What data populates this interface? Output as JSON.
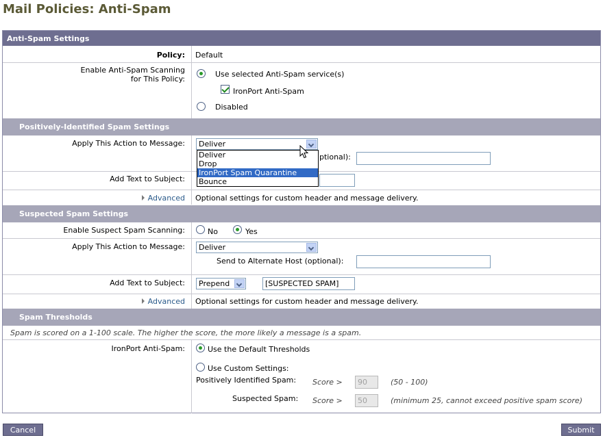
{
  "page": {
    "title": "Mail Policies: Anti-Spam"
  },
  "settings": {
    "header": "Anti-Spam Settings",
    "policy_label": "Policy:",
    "policy_value": "Default",
    "enable_label_1": "Enable Anti-Spam Scanning",
    "enable_label_2": "for This Policy:",
    "use_service": "Use selected Anti-Spam service(s)",
    "ironport": "IronPort Anti-Spam",
    "disabled": "Disabled"
  },
  "positive": {
    "header": "Positively-Identified Spam Settings",
    "action_label": "Apply This Action to Message:",
    "action_value": "Deliver",
    "alt_host_partial": "ptional):",
    "options": [
      "Deliver",
      "Drop",
      "IronPort Spam Quarantine",
      "Bounce"
    ],
    "subject_label": "Add Text to Subject:",
    "advanced": "Advanced",
    "advanced_desc": "Optional settings for custom header and message delivery."
  },
  "suspected": {
    "header": "Suspected Spam Settings",
    "enable_label": "Enable Suspect Spam Scanning:",
    "no": "No",
    "yes": "Yes",
    "action_label": "Apply This Action to Message:",
    "action_value": "Deliver",
    "alt_host_label": "Send to Alternate Host (optional):",
    "subject_label": "Add Text to Subject:",
    "subject_mode": "Prepend",
    "subject_text": "[SUSPECTED SPAM]",
    "advanced": "Advanced",
    "advanced_desc": "Optional settings for custom header and message delivery."
  },
  "thresholds": {
    "header": "Spam Thresholds",
    "note": "Spam is scored on a 1-100 scale. The higher the score, the more likely a message is a spam.",
    "engine_label": "IronPort Anti-Spam:",
    "default": "Use the Default Thresholds",
    "custom": "Use Custom Settings:",
    "positive_label": "Positively Identified Spam:",
    "score_gt": "Score >",
    "positive_value": "90",
    "positive_range": "(50 - 100)",
    "suspected_label": "Suspected Spam:",
    "suspected_value": "50",
    "suspected_range": "(minimum 25, cannot exceed positive spam score)"
  },
  "buttons": {
    "cancel": "Cancel",
    "submit": "Submit"
  }
}
